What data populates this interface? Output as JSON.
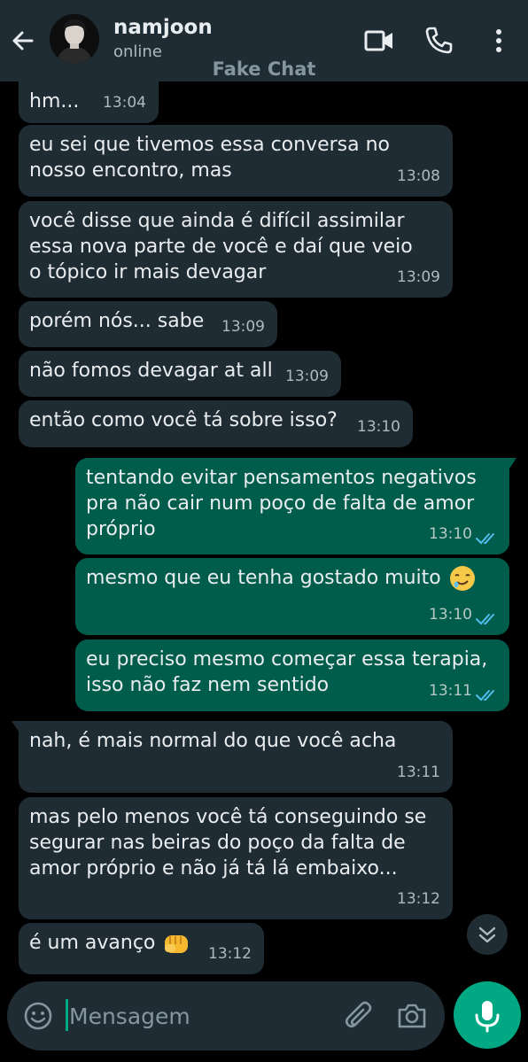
{
  "header": {
    "contact_name": "namjoon",
    "status": "online",
    "watermark": "Fake Chat"
  },
  "messages": [
    {
      "dir": "in",
      "text": "hm...",
      "time": "13:04"
    },
    {
      "dir": "in",
      "text": "eu sei que tivemos essa conversa no nosso encontro, mas",
      "time": "13:08"
    },
    {
      "dir": "in",
      "text": "você disse que ainda é difícil assimilar essa nova parte de você e daí que veio o tópico ir mais devagar",
      "time": "13:09"
    },
    {
      "dir": "in",
      "text": "porém nós... sabe",
      "time": "13:09"
    },
    {
      "dir": "in",
      "text": "não fomos devagar at all",
      "time": "13:09"
    },
    {
      "dir": "in",
      "text": "então como você tá sobre isso?",
      "time": "13:10"
    },
    {
      "dir": "out",
      "text": "tentando evitar pensamentos negativos pra não cair num poço de falta de amor próprio",
      "time": "13:10",
      "status": "read"
    },
    {
      "dir": "out",
      "text": "mesmo que eu tenha gostado muito",
      "emoji": "drooling-face",
      "time": "13:10",
      "status": "read"
    },
    {
      "dir": "out",
      "text": "eu preciso mesmo começar essa terapia, isso não faz nem sentido",
      "time": "13:11",
      "status": "read"
    },
    {
      "dir": "in",
      "text": "nah, é mais normal do que você acha",
      "time": "13:11"
    },
    {
      "dir": "in",
      "text": "mas pelo menos você tá conseguindo se segurar nas beiras do poço da falta de amor próprio e não já tá lá embaixo...",
      "time": "13:12"
    },
    {
      "dir": "in",
      "text": "é um avanço",
      "emoji": "oncoming-fist",
      "time": "13:12"
    }
  ],
  "composer": {
    "placeholder": "Mensagem"
  },
  "colors": {
    "header_bg": "#1f2c34",
    "incoming_bubble": "#202c33",
    "outgoing_bubble": "#005c4b",
    "accent": "#00a884",
    "read_ticks": "#53bdeb"
  },
  "icons": [
    "back-arrow-icon",
    "video-call-icon",
    "phone-icon",
    "more-options-icon",
    "double-chevron-down-icon",
    "emoji-icon",
    "attach-icon",
    "camera-icon",
    "mic-icon"
  ]
}
